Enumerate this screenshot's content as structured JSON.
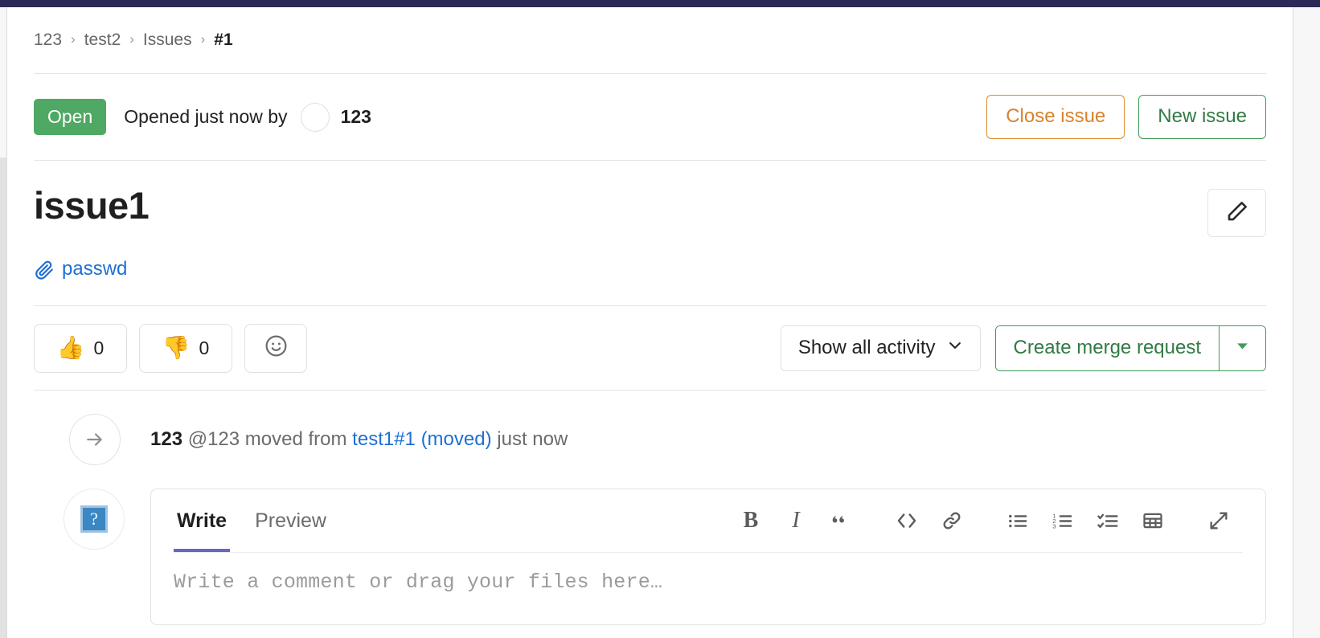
{
  "app": {
    "accent_navy": "#2b2a56",
    "link_blue": "#1f6fd4",
    "green": "#3f9c56",
    "orange": "#d9822b",
    "purple_tab": "#6666c4"
  },
  "breadcrumb": {
    "items": [
      {
        "label": "123",
        "current": false
      },
      {
        "label": "test2",
        "current": false
      },
      {
        "label": "Issues",
        "current": false
      },
      {
        "label": "#1",
        "current": true
      }
    ],
    "separator": "›"
  },
  "status": {
    "badge": "Open",
    "opened_text": "Opened just now by",
    "author": "123",
    "close_button": "Close issue",
    "new_button": "New issue"
  },
  "issue": {
    "title": "issue1",
    "edit_icon": "pencil-icon",
    "attachment": {
      "icon": "paperclip-icon",
      "label": "passwd"
    }
  },
  "reactions": {
    "thumbs_up": {
      "emoji": "👍",
      "count": "0"
    },
    "thumbs_down": {
      "emoji": "👎",
      "count": "0"
    },
    "add_reaction_icon": "smiley-face-icon"
  },
  "activity": {
    "select_label": "Show all activity",
    "caret_icon": "chevron-down-icon"
  },
  "merge_request": {
    "label": "Create merge request",
    "caret_icon": "chevron-down-icon"
  },
  "system_note": {
    "icon": "arrow-right-icon",
    "author": "123",
    "handle": "@123",
    "action": "moved from",
    "source_link": "test1#1 (moved)",
    "time": "just now"
  },
  "comment_editor": {
    "avatar_icon": "broken-image-icon",
    "avatar_glyph": "?",
    "tabs": [
      {
        "label": "Write",
        "active": true
      },
      {
        "label": "Preview",
        "active": false
      }
    ],
    "toolbar": [
      {
        "name": "bold-icon",
        "glyph": "B"
      },
      {
        "name": "italic-icon",
        "glyph": "I"
      },
      {
        "name": "quote-icon",
        "glyph": "”"
      },
      {
        "name": "code-icon",
        "glyph": "</>"
      },
      {
        "name": "link-icon",
        "glyph": "🔗"
      },
      {
        "name": "bullet-list-icon",
        "glyph": "•—"
      },
      {
        "name": "numbered-list-icon",
        "glyph": "1—"
      },
      {
        "name": "task-list-icon",
        "glyph": "✓—"
      },
      {
        "name": "table-icon",
        "glyph": "▤"
      },
      {
        "name": "fullscreen-icon",
        "glyph": "⤡"
      }
    ],
    "placeholder": "Write a comment or drag your files here…"
  }
}
